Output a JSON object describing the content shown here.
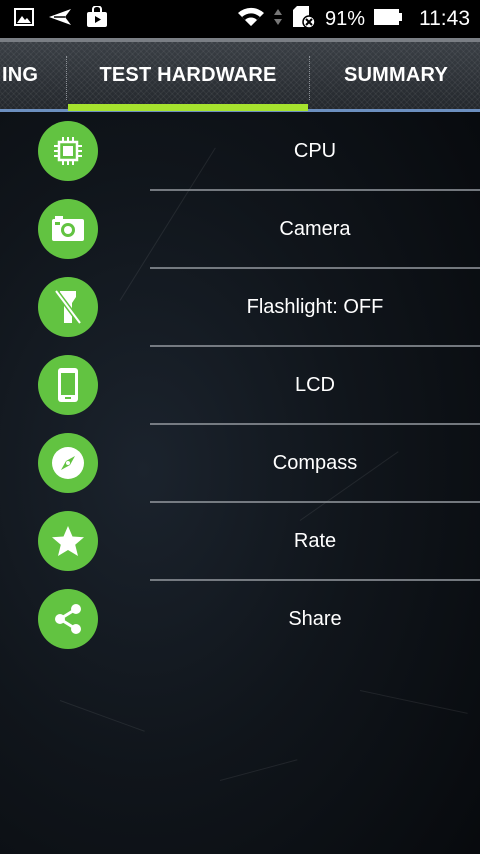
{
  "status_bar": {
    "battery_percent": "91%",
    "time": "11:43",
    "icons": [
      "image-icon",
      "send-icon",
      "play-store-icon",
      "wifi-icon",
      "sd-card-error-icon",
      "battery-icon"
    ]
  },
  "tabs": [
    {
      "label": "ING"
    },
    {
      "label": "TEST HARDWARE",
      "selected": true
    },
    {
      "label": "SUMMARY"
    }
  ],
  "colors": {
    "accent": "#a6e22e",
    "icon_bg": "#62c341"
  },
  "items": [
    {
      "label": "CPU",
      "icon": "cpu-chip-icon"
    },
    {
      "label": "Camera",
      "icon": "camera-icon"
    },
    {
      "label": "Flashlight: OFF",
      "icon": "flashlight-off-icon"
    },
    {
      "label": "LCD",
      "icon": "smartphone-icon"
    },
    {
      "label": "Compass",
      "icon": "compass-icon"
    },
    {
      "label": "Rate",
      "icon": "star-icon"
    },
    {
      "label": "Share",
      "icon": "share-icon"
    }
  ]
}
